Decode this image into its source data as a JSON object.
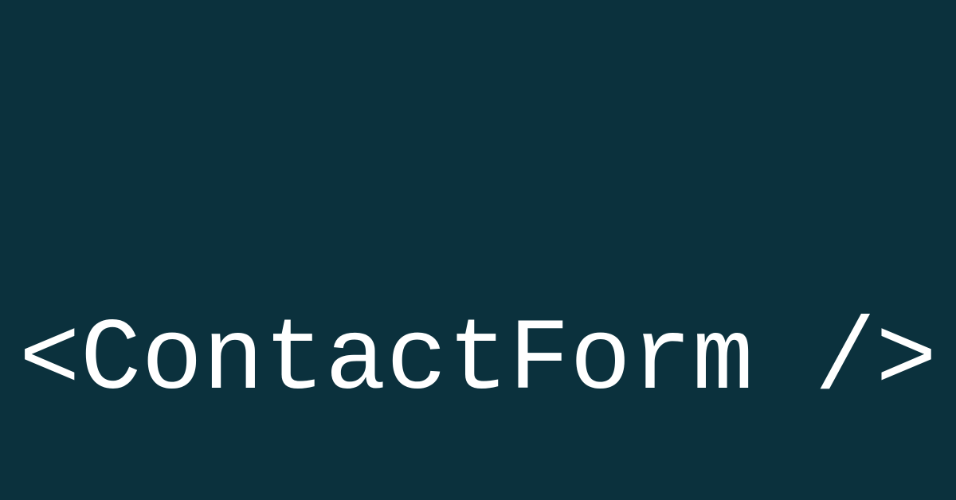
{
  "main": {
    "code_text": "<ContactForm />"
  },
  "colors": {
    "background": "#0b313d",
    "text": "#ffffff"
  }
}
